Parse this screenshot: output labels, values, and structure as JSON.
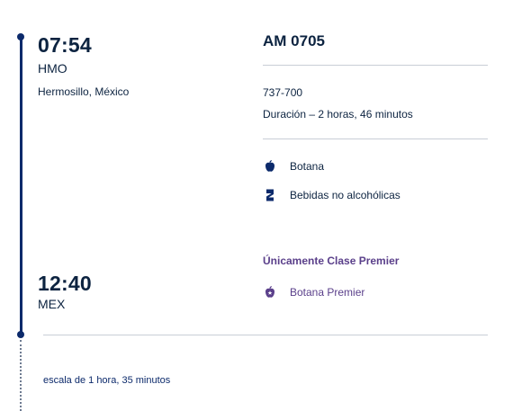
{
  "departure": {
    "time": "07:54",
    "code": "HMO",
    "city": "Hermosillo, México"
  },
  "arrival": {
    "time": "12:40",
    "code": "MEX"
  },
  "flight": {
    "number": "AM 0705",
    "aircraft": "737-700",
    "duration": "Duración – 2 horas, 46 minutos"
  },
  "services": [
    {
      "label": "Botana",
      "icon": "apple-icon"
    },
    {
      "label": "Bebidas no alcohólicas",
      "icon": "drink-icon"
    }
  ],
  "premier": {
    "heading": "Únicamente Clase Premier",
    "services": [
      {
        "label": "Botana Premier",
        "icon": "premier-apple-icon"
      }
    ]
  },
  "layover": {
    "text": "escala de 1 hora, 35 minutos"
  },
  "colors": {
    "navy": "#0c2340",
    "timeline": "#0c2a6b",
    "premier": "#5a3f8a",
    "divider": "#c9ced6"
  }
}
